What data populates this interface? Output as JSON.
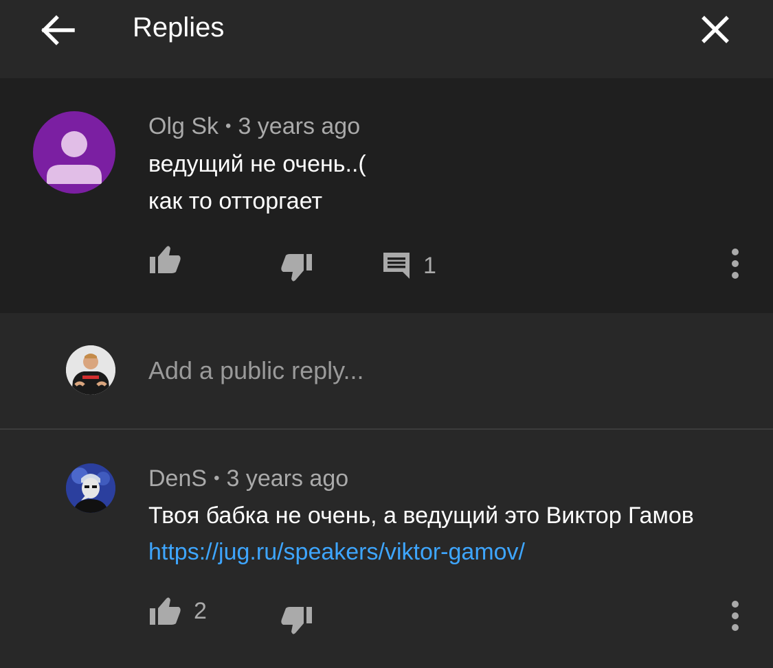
{
  "header": {
    "title": "Replies",
    "back_icon": "arrow-left-icon",
    "close_icon": "close-icon"
  },
  "parent_comment": {
    "author": "Olg Sk",
    "separator": "•",
    "time": "3 years ago",
    "lines": [
      "ведущий не очень..(",
      "как то отторгает"
    ],
    "reply_count": "1",
    "avatar_color": "#7b1fa2"
  },
  "reply_box": {
    "placeholder": "Add a public reply..."
  },
  "replies": [
    {
      "author": "DenS",
      "separator": "•",
      "time": "3 years ago",
      "text": "Твоя бабка не очень, а ведущий это Виктор Гамов",
      "link": "https://jug.ru/speakers/viktor-gamov/",
      "like_count": "2"
    }
  ],
  "colors": {
    "background": "#282828",
    "highlight": "#1f1f1f",
    "secondary_text": "#aaaaaa",
    "link": "#3ea6ff"
  }
}
